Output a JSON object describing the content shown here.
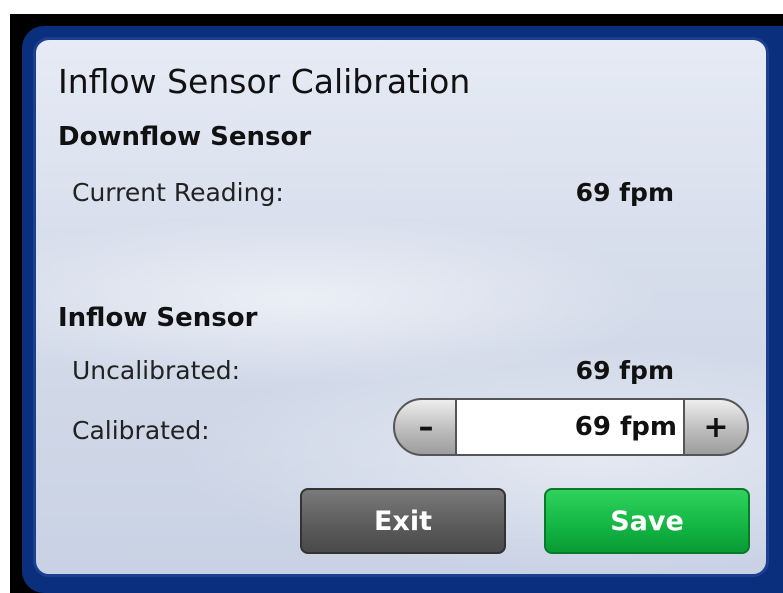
{
  "dialog": {
    "title": "Inflow Sensor Calibration"
  },
  "downflow": {
    "heading": "Downflow Sensor",
    "current_label": "Current Reading:",
    "current_value": "69 fpm"
  },
  "inflow": {
    "heading": "Inflow Sensor",
    "uncalibrated_label": "Uncalibrated:",
    "uncalibrated_value": "69 fpm",
    "calibrated_label": "Calibrated:",
    "calibrated_value": "69 fpm",
    "minus_label": "–",
    "plus_label": "+"
  },
  "buttons": {
    "exit_label": "Exit",
    "save_label": "Save"
  },
  "colors": {
    "frame": "#0a2f7c",
    "save": "#13b443",
    "exit": "#5a5a5a"
  }
}
